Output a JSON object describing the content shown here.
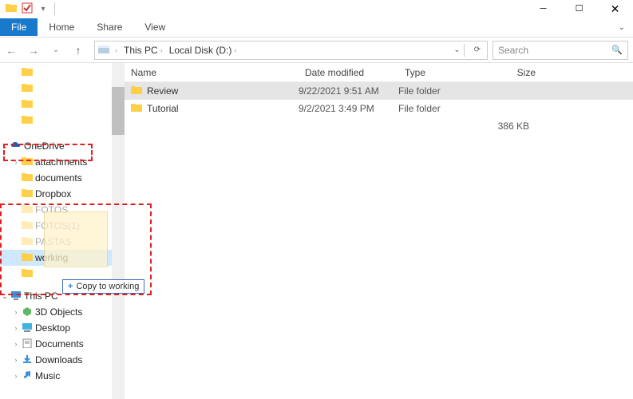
{
  "title_bar": {
    "chevron": "⌄"
  },
  "ribbon": {
    "file": "File",
    "home": "Home",
    "share": "Share",
    "view": "View"
  },
  "nav": {
    "back": "←",
    "forward": "→",
    "dropdown": "⌄",
    "up": "↑"
  },
  "address": {
    "root_icon": "▸",
    "crumbs": [
      "This PC",
      "Local Disk (D:)"
    ],
    "sep": "›",
    "dropdown": "⌄",
    "refresh": "⟳"
  },
  "search": {
    "placeholder": "Search",
    "icon": "🔍"
  },
  "tree": {
    "top": [
      {
        "exp": "",
        "label": "",
        "kind": "folder"
      },
      {
        "exp": "",
        "label": "",
        "kind": "folder"
      },
      {
        "exp": "",
        "label": "",
        "kind": "folder"
      },
      {
        "exp": "",
        "label": "",
        "kind": "folder"
      }
    ],
    "onedrive": {
      "label": "OneDrive",
      "expanded": true
    },
    "onedrive_children": [
      {
        "exp": ">",
        "label": "attachments"
      },
      {
        "exp": "",
        "label": "documents"
      },
      {
        "exp": "",
        "label": "Dropbox"
      },
      {
        "exp": "",
        "label": "FOTOS",
        "faded": true
      },
      {
        "exp": "",
        "label": "FOTOS(1)",
        "faded": true
      },
      {
        "exp": "",
        "label": "PASTAS",
        "faded": true
      },
      {
        "exp": "",
        "label": "working",
        "selected": true
      },
      {
        "exp": "",
        "label": ""
      }
    ],
    "thispc": {
      "label": "This PC",
      "expanded": true
    },
    "thispc_children": [
      {
        "exp": ">",
        "label": "3D Objects",
        "icon": "3d"
      },
      {
        "exp": ">",
        "label": "Desktop",
        "icon": "desktop"
      },
      {
        "exp": ">",
        "label": "Documents",
        "icon": "docs"
      },
      {
        "exp": ">",
        "label": "Downloads",
        "icon": "down"
      },
      {
        "exp": ">",
        "label": "Music",
        "icon": "music"
      }
    ]
  },
  "drag": {
    "tooltip": "Copy to working"
  },
  "headers": {
    "name": "Name",
    "date": "Date modified",
    "type": "Type",
    "size": "Size"
  },
  "rows": [
    {
      "name": "Review",
      "date": "9/22/2021 9:51 AM",
      "type": "File folder",
      "size": "",
      "highlight": true
    },
    {
      "name": "Tutorial",
      "date": "9/2/2021 3:49 PM",
      "type": "File folder",
      "size": ""
    }
  ],
  "summary_size": "386 KB"
}
